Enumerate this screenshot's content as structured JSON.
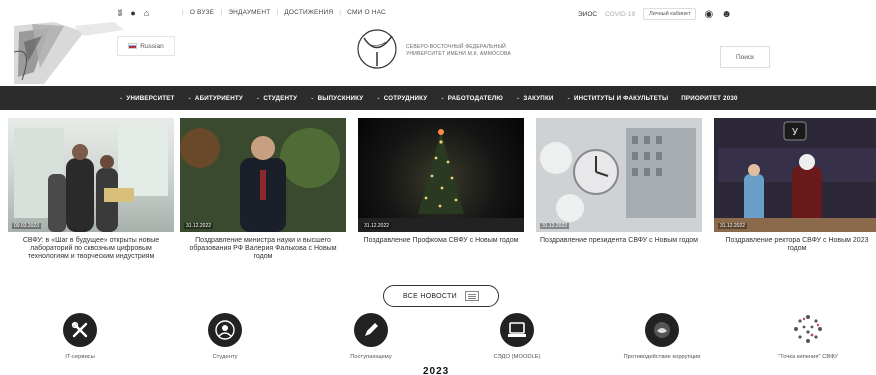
{
  "topbar": {
    "icons": [
      "vk-icon",
      "ok-icon",
      "telegram-icon"
    ],
    "links": [
      "О ВУЗЕ",
      "ЭНДАУМЕНТ",
      "ДОСТИЖЕНИЯ",
      "СМИ О НАС"
    ],
    "eios": "ЭИОС",
    "covid": "COVID-19",
    "cabinet": "Личный кабинет"
  },
  "header": {
    "language": "Russian",
    "uni_line1": "СЕВЕРО-ВОСТОЧНЫЙ ФЕДЕРАЛЬНЫЙ",
    "uni_line2": "УНИВЕРСИТЕТ ИМЕНИ М.К. АММОСОВА",
    "search_label": "Поиск"
  },
  "nav": {
    "items": [
      "УНИВЕРСИТЕТ",
      "АБИТУРИЕНТУ",
      "СТУДЕНТУ",
      "ВЫПУСКНИКУ",
      "СОТРУДНИКУ",
      "РАБОТОДАТЕЛЮ",
      "ЗАКУПКИ",
      "ИНСТИТУТЫ И ФАКУЛЬТЕТЫ",
      "ПРИОРИТЕТ 2030"
    ]
  },
  "news": [
    {
      "date": "09.03.2023",
      "caption": "СВФУ: в «Шаг в будущее» открыты новые лабораторий по сквозным цифровым технологиям и творческим индустриям"
    },
    {
      "date": "31.12.2022",
      "caption": "Поздравление министра науки и высшего образования РФ Валерия Фалькова с Новым годом"
    },
    {
      "date": "31.12.2022",
      "caption": "Поздравление Профкома СВФУ с Новым годом"
    },
    {
      "date": "31.12.2022",
      "caption": "Поздравление президента СВФУ с Новым годом"
    },
    {
      "date": "31.12.2022",
      "caption": "Поздравление ректора СВФУ с Новым 2023 годом"
    }
  ],
  "all_news_label": "ВСЕ НОВОСТИ",
  "services": [
    {
      "label": "IT-сервисы",
      "icon": "tools-icon"
    },
    {
      "label": "Студенту",
      "icon": "student-icon"
    },
    {
      "label": "Поступающему",
      "icon": "pencil-icon"
    },
    {
      "label": "СЭДО (MOODLE)",
      "icon": "laptop-icon"
    },
    {
      "label": "Противодействие коррупции",
      "icon": "anti-corruption-icon"
    },
    {
      "label": "\"Точка кипения\" СВФУ",
      "icon": "dots-icon"
    }
  ],
  "year_text": "2023"
}
